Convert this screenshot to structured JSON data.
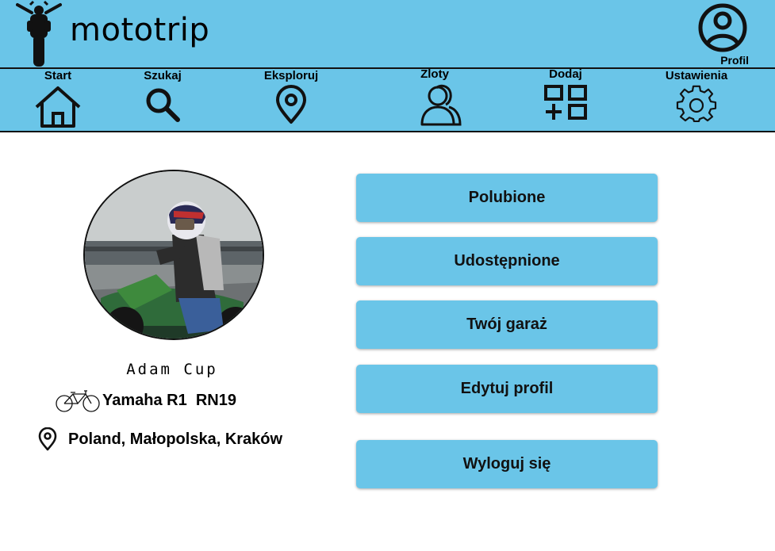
{
  "app": {
    "title": "mototrip"
  },
  "colors": {
    "header_bg": "#6ac5e8",
    "button_bg": "#6ac5e8",
    "text": "#111111"
  },
  "header": {
    "logo_icon": "motorcycle-front-icon",
    "profile_label": "Profil",
    "profile_icon": "user-circle-icon"
  },
  "nav": {
    "items": [
      {
        "label": "Start",
        "icon": "home-icon"
      },
      {
        "label": "Szukaj",
        "icon": "search-icon"
      },
      {
        "label": "Eksploruj",
        "icon": "map-pin-icon"
      },
      {
        "label": "Zloty",
        "icon": "users-icon"
      },
      {
        "label": "Dodaj",
        "icon": "add-grid-icon"
      },
      {
        "label": "Ustawienia",
        "icon": "gear-icon"
      }
    ]
  },
  "profile": {
    "name": "Adam Cup",
    "bike": "Yamaha R1  RN19",
    "bike_icon": "bicycle-icon",
    "location": "Poland, Małopolska, Kraków",
    "location_icon": "map-pin-icon"
  },
  "menu": {
    "liked": "Polubione",
    "shared": "Udostępnione",
    "garage": "Twój garaż",
    "edit_profile": "Edytuj profil",
    "logout": "Wyloguj się"
  }
}
